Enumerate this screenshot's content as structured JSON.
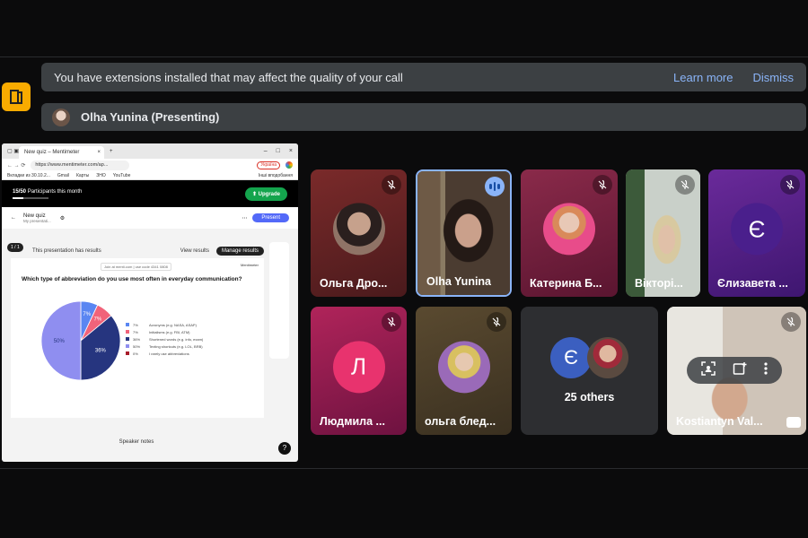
{
  "banner": {
    "message": "You have extensions installed that may affect the quality of your call",
    "learn_more": "Learn more",
    "dismiss": "Dismiss"
  },
  "presenting": {
    "label": "Olha Yunina (Presenting)"
  },
  "shared_screen": {
    "tab_title": "New quiz – Mentimeter",
    "url": "https://www.mentimeter.com/ap...",
    "language_chip": "Україна",
    "bookmarks": [
      "Вкладки из 30.10.2...",
      "Gmail",
      "Карты",
      "ЗНО",
      "YouTube",
      "Інші вподобання"
    ],
    "participants": "15/50",
    "participants_label": "Participants this month",
    "participants_fraction": 0.3,
    "upgrade": "Upgrade",
    "quiz_title": "New quiz",
    "quiz_sub": "My presentati...",
    "present": "Present",
    "page_badge": "1 / 1",
    "results_note": "This presentation has results",
    "view_results": "View results",
    "manage_results": "Manage results",
    "join_text": "Join at menti.com | use code 4341 0808",
    "brand": "Mentimeter",
    "question": "Which type of abbreviation do you use most often in everyday communication?",
    "speaker_notes": "Speaker notes",
    "help": "?"
  },
  "chart_data": {
    "type": "pie",
    "categories": [
      "Acronyms (e.g. NASA, ASAP)",
      "Initialisms (e.g. FBI, ATM)",
      "Shortened words (e.g. info, exam)",
      "Texting shortcuts (e.g. LOL, BRB)",
      "I rarely use abbreviations"
    ],
    "values": [
      7,
      7,
      36,
      50,
      0
    ],
    "labels": [
      "7%",
      "7%",
      "36%",
      "50%",
      "0%"
    ],
    "colors": [
      "#5a86f2",
      "#f1637a",
      "#26357f",
      "#8f8ef0",
      "#a81c2a"
    ],
    "title": "Which type of abbreviation do you use most often in everyday communication?"
  },
  "participants": [
    {
      "name": "Ольга Дро...",
      "muted": true
    },
    {
      "name": "Olha Yunina",
      "muted": false
    },
    {
      "name": "Катерина Б...",
      "muted": true
    },
    {
      "name": "Вікторі...",
      "muted": true
    },
    {
      "name": "Єлизавета ...",
      "muted": true,
      "initial": "Є"
    },
    {
      "name": "Людмила ...",
      "muted": true,
      "initial": "Л"
    },
    {
      "name": "ольга блед...",
      "muted": true
    },
    {
      "name": "25 others",
      "initial": "Є"
    },
    {
      "name": "Kostiantyn Val...",
      "muted": true
    }
  ],
  "colors": {
    "banner_bg": "#3c4043",
    "link": "#8ab4f8",
    "badge": "#f9ab00"
  }
}
